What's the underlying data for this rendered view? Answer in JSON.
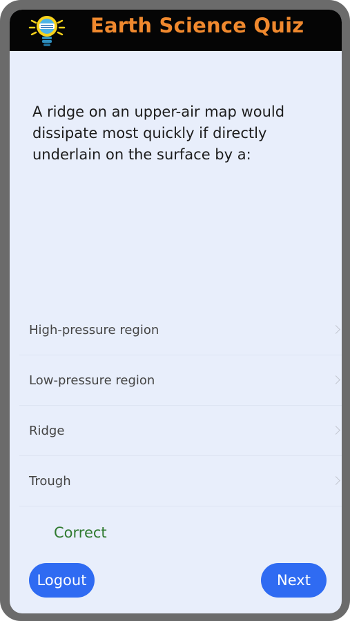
{
  "header": {
    "title": "Earth Science Quiz",
    "logo_icon": "lightbulb-icon",
    "title_color": "#f0892e"
  },
  "question": {
    "text": "A ridge on an upper-air map would dissipate most quickly if directly underlain on the surface by a:"
  },
  "options": [
    {
      "label": "High-pressure region",
      "icon": "chevron-right-icon"
    },
    {
      "label": "Low-pressure region",
      "icon": "chevron-right-icon"
    },
    {
      "label": "Ridge",
      "icon": "chevron-right-icon"
    },
    {
      "label": "Trough",
      "icon": "chevron-right-icon"
    }
  ],
  "result": {
    "text": "Correct",
    "color": "#2f7a2f"
  },
  "buttons": {
    "logout_label": "Logout",
    "next_label": "Next",
    "color": "#2f6bf2"
  }
}
